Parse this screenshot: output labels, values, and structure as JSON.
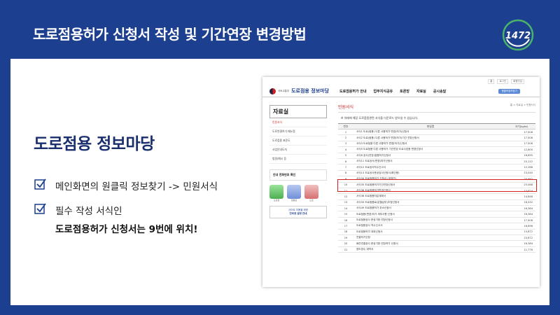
{
  "header": {
    "title": "도로점용허가 신청서 작성 및 기간연장 변경방법"
  },
  "logo": {
    "text": "1472",
    "color": "#49b36b"
  },
  "slide": {
    "heading": "도로점용 정보마당",
    "bullets": [
      {
        "text": "메인화면의 원클릭 정보찾기 -> 민원서식"
      },
      {
        "text": "필수 작성 서식인",
        "line2": "도로점용허가 신청서는 9번에 위치!"
      }
    ]
  },
  "screenshot": {
    "top_links": [
      "홈",
      "로그인",
      "회원가입"
    ],
    "gov_label": "국토교통부",
    "site_name": "도로점용 정보마당",
    "nav": [
      "도로점용허가 안내",
      "업무지식공유",
      "토론방",
      "자료실",
      "공시송달"
    ],
    "nav_button": "원클릭정보찾기",
    "sidebar": {
      "title": "자료실",
      "items": [
        "민원서식",
        "도로연결허가 매뉴얼",
        "도로점용 표준도",
        "사업안내도지",
        "법령/예시 등"
      ],
      "box_text": "안내 전화번호 확인",
      "icons": [
        "도로점",
        "점용료",
        "도로"
      ],
      "banner_line1": "사이트 이용을 위한",
      "banner_line2": "인터넷 설정 안내"
    },
    "content": {
      "title": "민원서식",
      "breadcrumb": "홈 > 자료실 > 민원서식",
      "notice": "※ 아래에 해당 도로점용관련 서식을 다운로드 받으실 수 있습니다.",
      "columns": [
        "번호",
        "파일명",
        "크기(byte)"
      ],
      "rows": [
        {
          "no": "1",
          "name": "서식1 도로(점용) 다른 사용허가 변경(허가)신청서",
          "size": "17,408"
        },
        {
          "no": "2",
          "name": "서식2 도로(점용) 다른 사용허가 변경(허가)기간 연장신청서",
          "size": "17,408"
        },
        {
          "no": "3",
          "name": "서식3 도로점용 다른 사용허가 변경(허가)신청서",
          "size": "17,408"
        },
        {
          "no": "4",
          "name": "서식5 도로점용 다른 사용허가 기간연장 도로사업용 변경신청서",
          "size": "12,800"
        },
        {
          "no": "5",
          "name": "서식6 공사(연장)점용허가신청서",
          "size": "16,895"
        },
        {
          "no": "6",
          "name": "서식11 도로공사(변경)허가신청서",
          "size": "20,112"
        },
        {
          "no": "7",
          "name": "서식12 도로공사착수신고서",
          "size": "12,288"
        },
        {
          "no": "8",
          "name": "서식13 도로공사준공검사신청서(확인용)",
          "size": "23,040"
        },
        {
          "no": "9",
          "name": "서식34 도로점용허가 신청서 (개정안)",
          "size": "20,992"
        },
        {
          "no": "10",
          "name": "서식35 도로점용허가기간연장신청서",
          "size": "25,088"
        },
        {
          "no": "11",
          "name": "서식36 도로점용허가변경신청서",
          "size": "13,824"
        },
        {
          "no": "12",
          "name": "서식38 도로점용처분계획서",
          "size": "14,848"
        },
        {
          "no": "13",
          "name": "서식33 도로점용료(분할납부)조정신청서",
          "size": "18,432"
        },
        {
          "no": "14",
          "name": "서식49 도로점용허가 취소신청서",
          "size": "16,384"
        },
        {
          "no": "15",
          "name": "도로점용(변경)허가 세부사항 신청서",
          "size": "16,384"
        },
        {
          "no": "16",
          "name": "도로점용공사 준공기한 연장신청서",
          "size": "17,408"
        },
        {
          "no": "17",
          "name": "도로점용공사 착수신고서",
          "size": "16,896"
        },
        {
          "no": "18",
          "name": "도로점용허가 대위신청서",
          "size": "15,872"
        },
        {
          "no": "19",
          "name": "연결허가신청",
          "size": "15,872"
        },
        {
          "no": "20",
          "name": "배관연결공사 준공기한 연장허가 신청서",
          "size": "16,384"
        },
        {
          "no": "21",
          "name": "양도양수 계약서",
          "size": "11,776"
        }
      ]
    }
  }
}
